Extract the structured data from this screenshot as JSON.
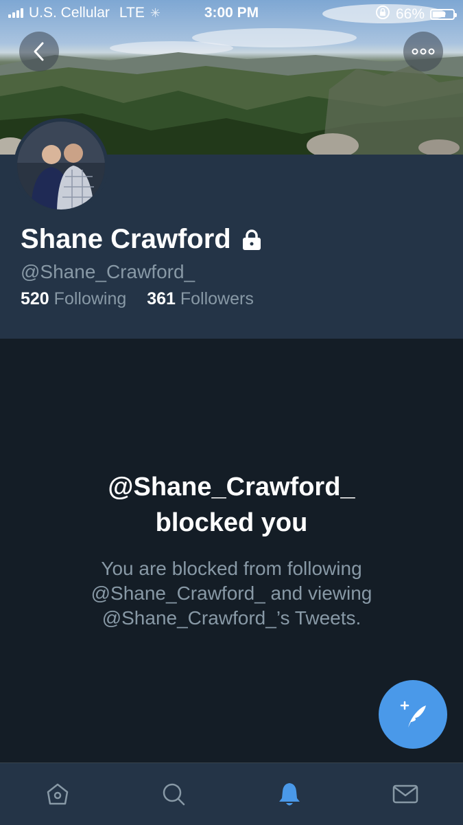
{
  "status_bar": {
    "carrier": "U.S. Cellular",
    "network": "LTE",
    "time": "3:00 PM",
    "battery_percent": "66%",
    "battery_level": 0.66
  },
  "header": {
    "back_icon": "chevron-left-icon",
    "more_icon": "more-dots-icon"
  },
  "profile": {
    "name": "Shane Crawford",
    "protected_icon": "lock-icon",
    "handle": "@Shane_Crawford_",
    "following_count": "520",
    "following_label": "Following",
    "followers_count": "361",
    "followers_label": "Followers"
  },
  "blocked": {
    "title_line1": "@Shane_Crawford_",
    "title_line2": "blocked you",
    "desc_line1": "You are blocked from following",
    "desc_line2": "@Shane_Crawford_ and viewing",
    "desc_line3": "@Shane_Crawford_’s Tweets."
  },
  "compose_icon": "compose-tweet-icon",
  "tabs": [
    {
      "icon": "home-icon",
      "active": false
    },
    {
      "icon": "search-icon",
      "active": false
    },
    {
      "icon": "notifications-bell-icon",
      "active": true
    },
    {
      "icon": "messages-envelope-icon",
      "active": false
    }
  ],
  "colors": {
    "background": "#141d26",
    "panel": "#243447",
    "secondary_text": "#8899a6",
    "accent": "#4a99e9"
  }
}
